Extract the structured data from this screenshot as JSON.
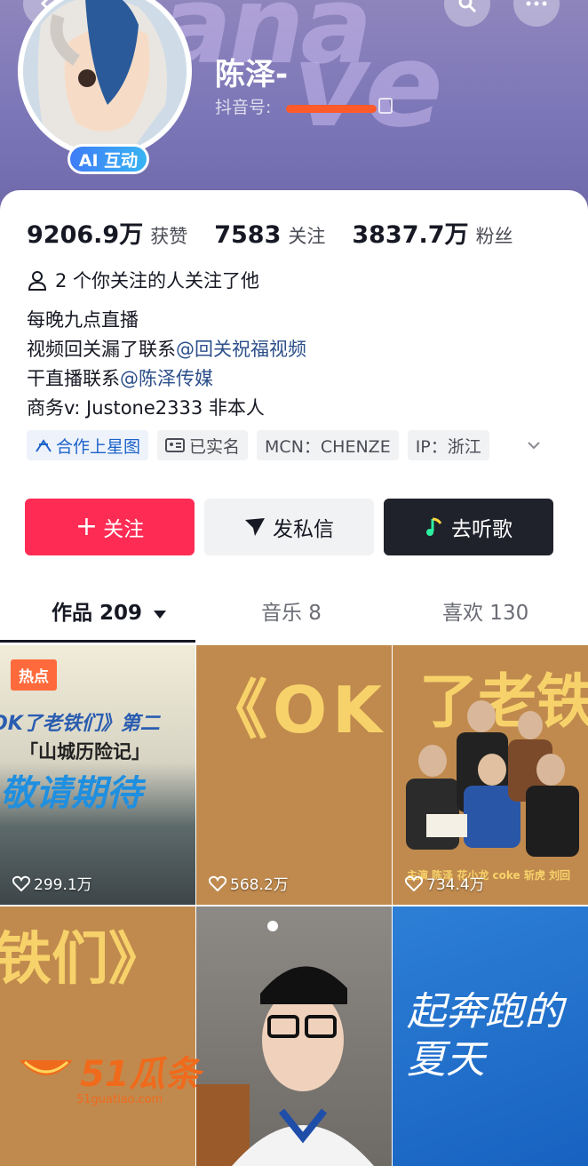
{
  "profile": {
    "name": "陈泽-",
    "douyin_id_label": "抖音号:",
    "ai_badge": "AI 互动"
  },
  "stats": [
    {
      "num": "9206.9万",
      "label": "获赞"
    },
    {
      "num": "7583",
      "label": "关注"
    },
    {
      "num": "3837.7万",
      "label": "粉丝"
    }
  ],
  "mutual": "2 个你关注的人关注了他",
  "bio": {
    "line1": "每晚九点直播",
    "line2_text": "视频回关漏了联系",
    "line2_at": "@回关祝福视频",
    "line3_text": "干直播联系",
    "line3_at": "@陈泽传媒",
    "line4": "商务v: Justone2333 非本人"
  },
  "tags": [
    "合作上星图",
    "已实名",
    "MCN：CHENZE",
    "IP：浙江"
  ],
  "actions": {
    "follow": "关注",
    "message": "发私信",
    "music": "去听歌"
  },
  "tabs": [
    {
      "label": "作品 209"
    },
    {
      "label": "音乐 8"
    },
    {
      "label": "喜欢 130"
    }
  ],
  "videos": [
    {
      "likes": "299.1万",
      "badge": "热点",
      "line1": "OK了老铁们》第二",
      "line2": "「山城历险记」",
      "line3": "敬请期待"
    },
    {
      "likes": "568.2万",
      "big": "《OK"
    },
    {
      "likes": "734.4万",
      "big": "了老铁",
      "credits": "主演 陈泽 花小龙 coke 斩虎 刘回"
    },
    {
      "big": "铁们》"
    },
    {},
    {
      "text": "起奔跑的夏天"
    }
  ],
  "watermark": {
    "brand": "51瓜条",
    "url": "51guatiao.com"
  },
  "colors": {
    "accent": "#fe2c55",
    "link": "#2c4f8a",
    "header": "#7b76b7"
  }
}
